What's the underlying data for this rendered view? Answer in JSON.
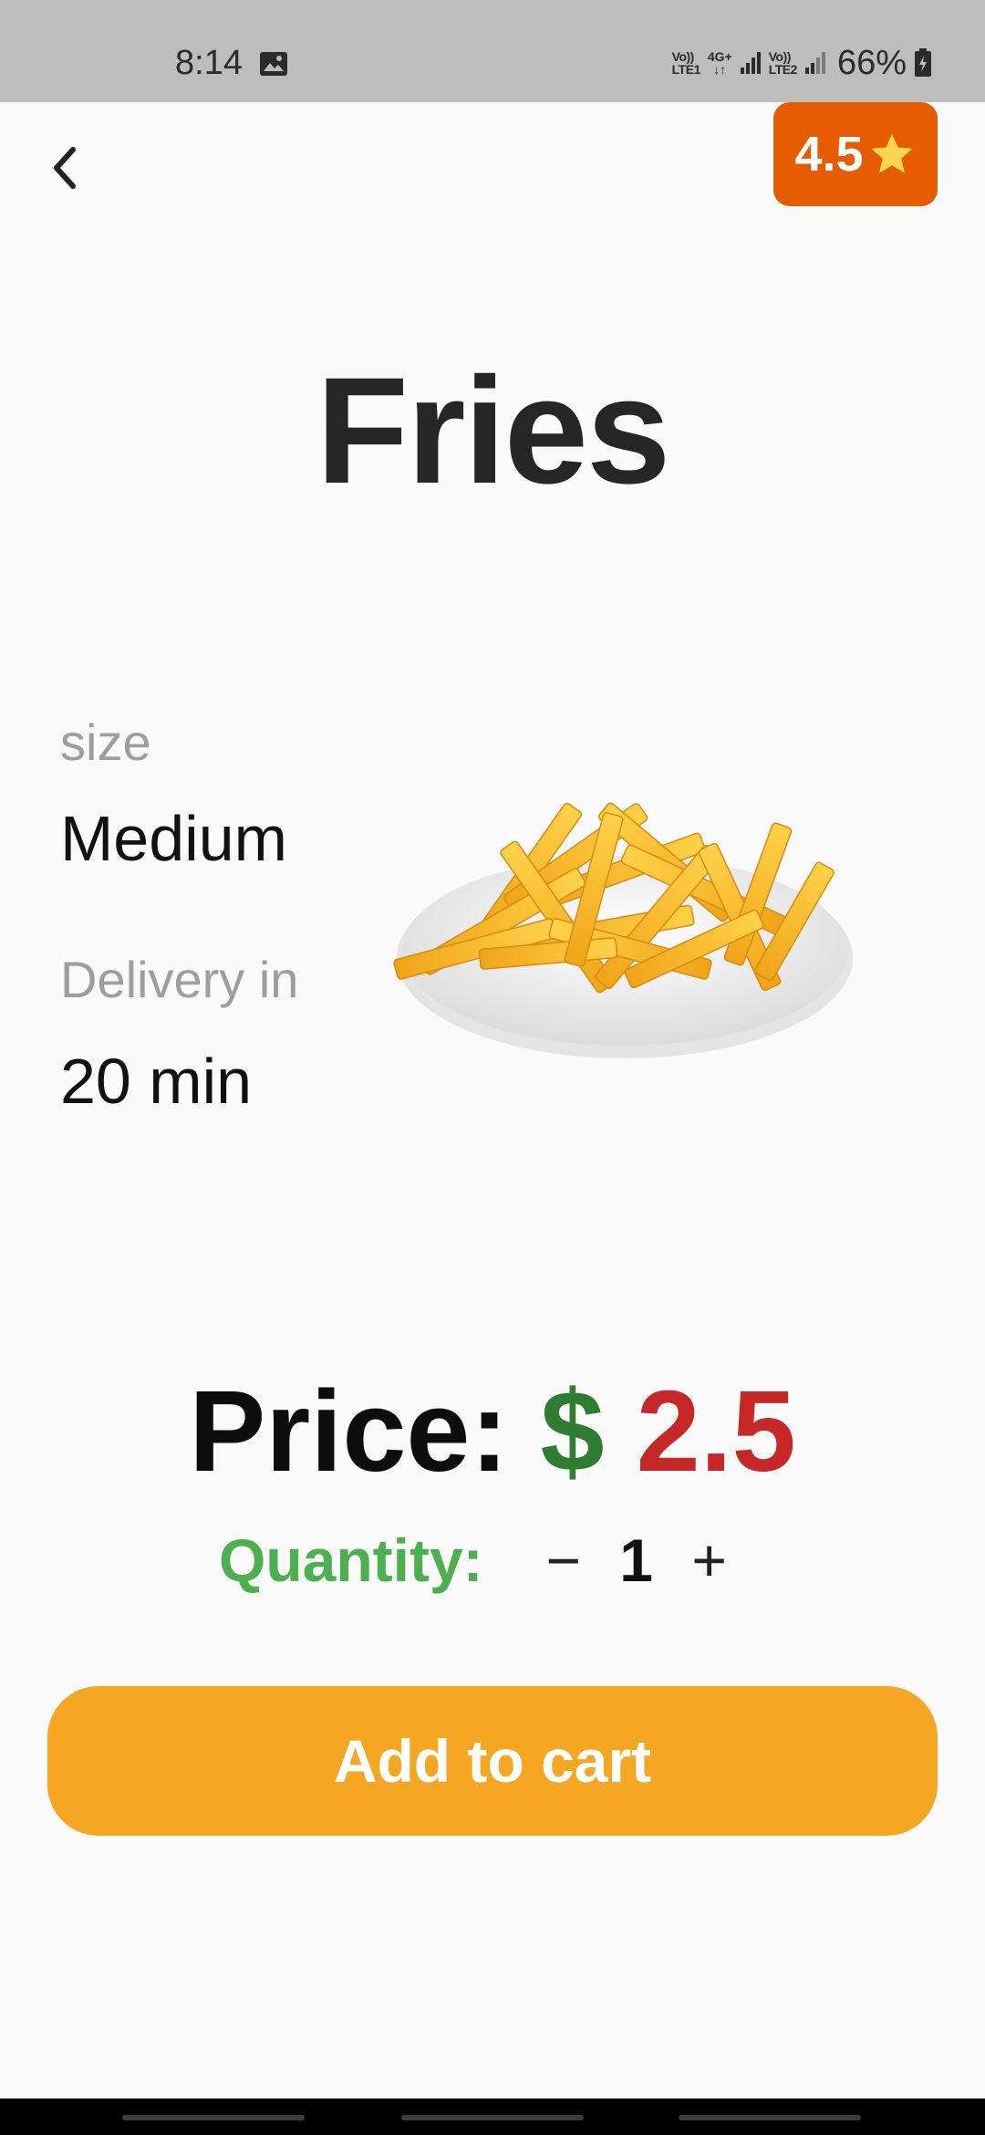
{
  "status_bar": {
    "time": "8:14",
    "sim1_top": "Vo))",
    "sim1_bottom": "LTE1",
    "network_top": "4G+",
    "network_bottom": "↓↑",
    "sim2_top": "Vo))",
    "sim2_bottom": "LTE2",
    "battery": "66%",
    "icons": [
      "gallery-icon",
      "signal-icon",
      "battery-charging-icon"
    ]
  },
  "header": {
    "back_icon": "chevron-left-icon",
    "rating": "4.5",
    "rating_icon": "star-icon",
    "rating_color": "#e65c00",
    "star_color": "#ffd54f"
  },
  "product": {
    "title": "Fries",
    "size_label": "size",
    "size_value": "Medium",
    "delivery_label": "Delivery in",
    "delivery_value": "20 min"
  },
  "price": {
    "label": "Price:",
    "currency": "$",
    "value": "2.5",
    "currency_color": "#2e7d32",
    "value_color": "#c62828"
  },
  "quantity": {
    "label": "Quantity:",
    "decrement": "−",
    "value": "1",
    "increment": "+",
    "label_color": "#4caf50"
  },
  "actions": {
    "add_to_cart": "Add to cart",
    "button_color": "#f5a623"
  }
}
